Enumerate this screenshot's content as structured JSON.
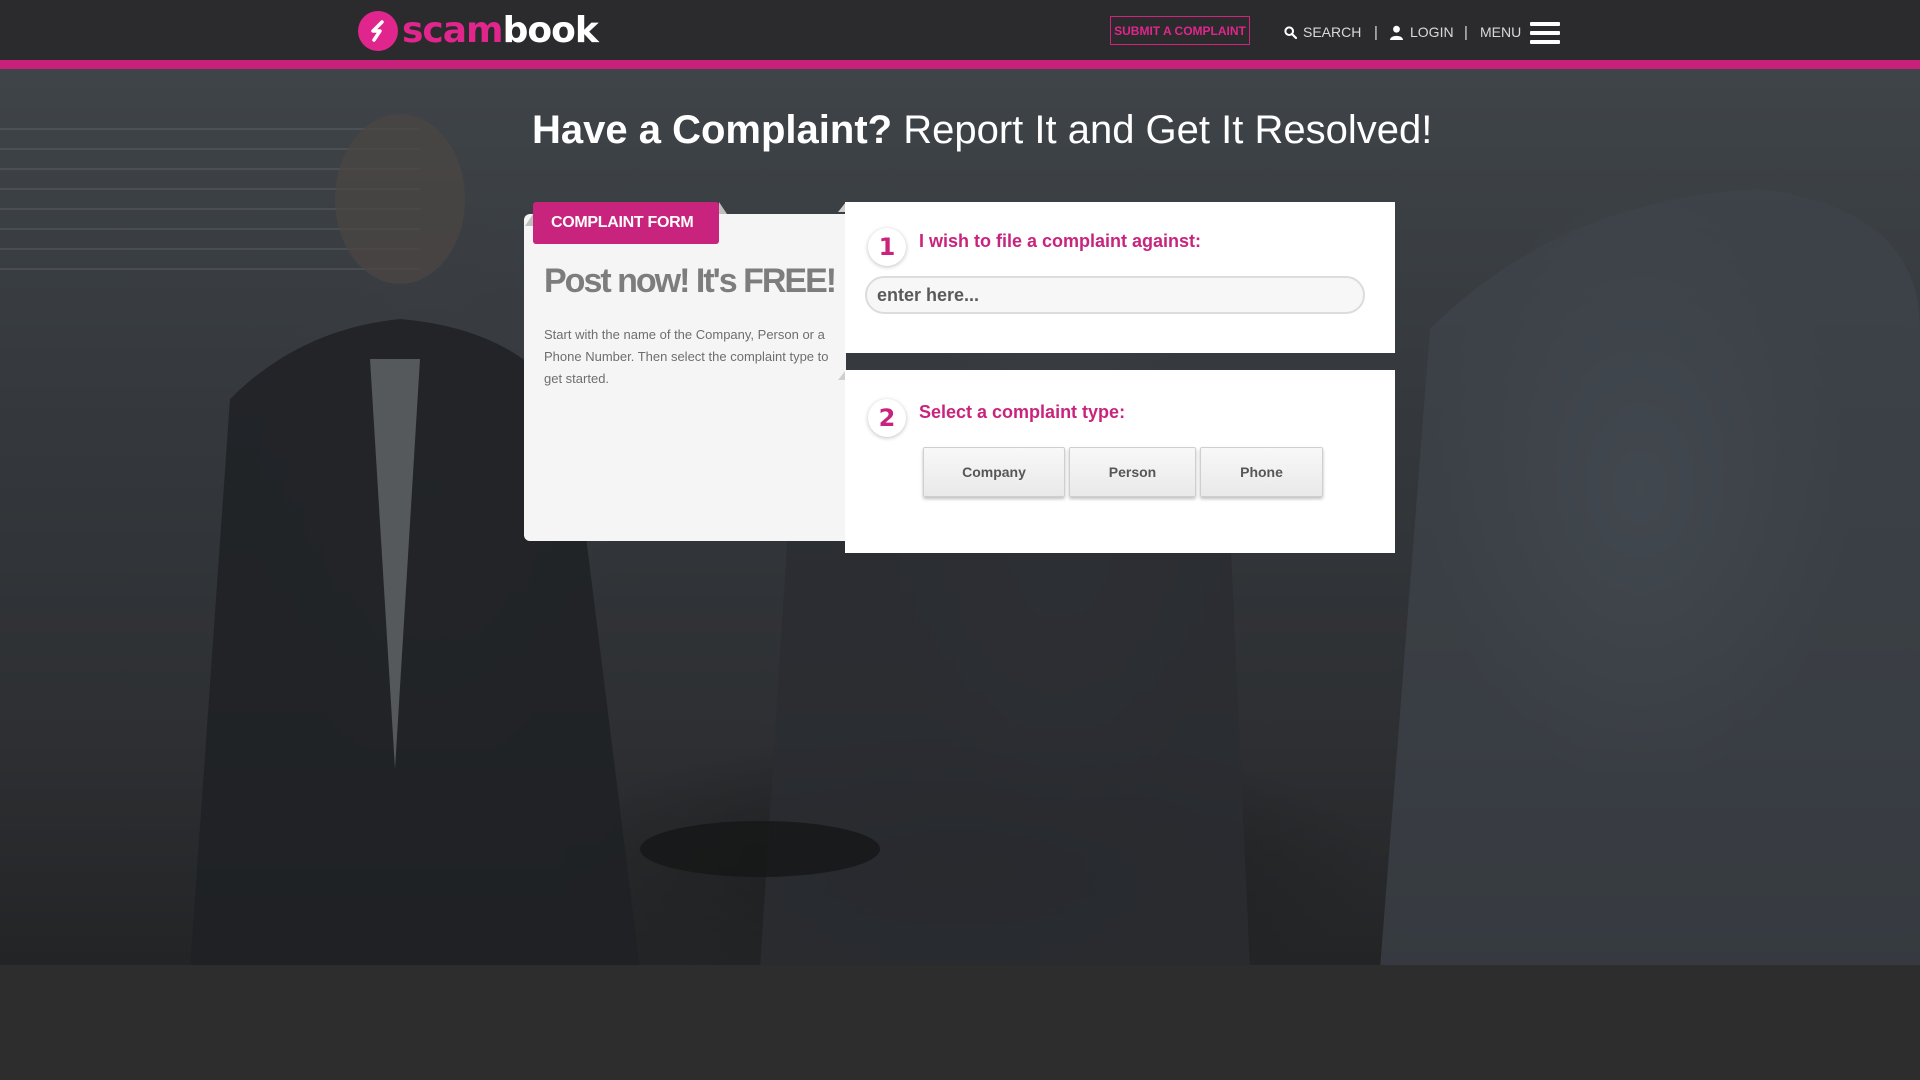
{
  "brand": {
    "logo_part1": "scam",
    "logo_part2": "book",
    "accent_color": "#c9247d"
  },
  "header": {
    "submit_label": "SUBMIT A COMPLAINT",
    "search_label": "SEARCH",
    "login_label": "LOGIN",
    "menu_label": "MENU",
    "separator": "|",
    "icons": [
      "logo-mark-icon",
      "search-icon",
      "user-icon",
      "hamburger-icon"
    ]
  },
  "hero": {
    "headline_bold": "Have a Complaint?",
    "headline_light": " Report It and Get It Resolved!"
  },
  "form_intro": {
    "tab_label": "COMPLAINT FORM",
    "title": "Post now! It's FREE!",
    "description": "Start with the name of the Company, Person or a Phone Number. Then select the complaint type to get started."
  },
  "step1": {
    "number": "1",
    "label": "I wish to file a complaint against:",
    "input_placeholder": "enter here...",
    "input_value": ""
  },
  "step2": {
    "number": "2",
    "label": "Select a complaint type:",
    "options": [
      "Company",
      "Person",
      "Phone"
    ]
  }
}
